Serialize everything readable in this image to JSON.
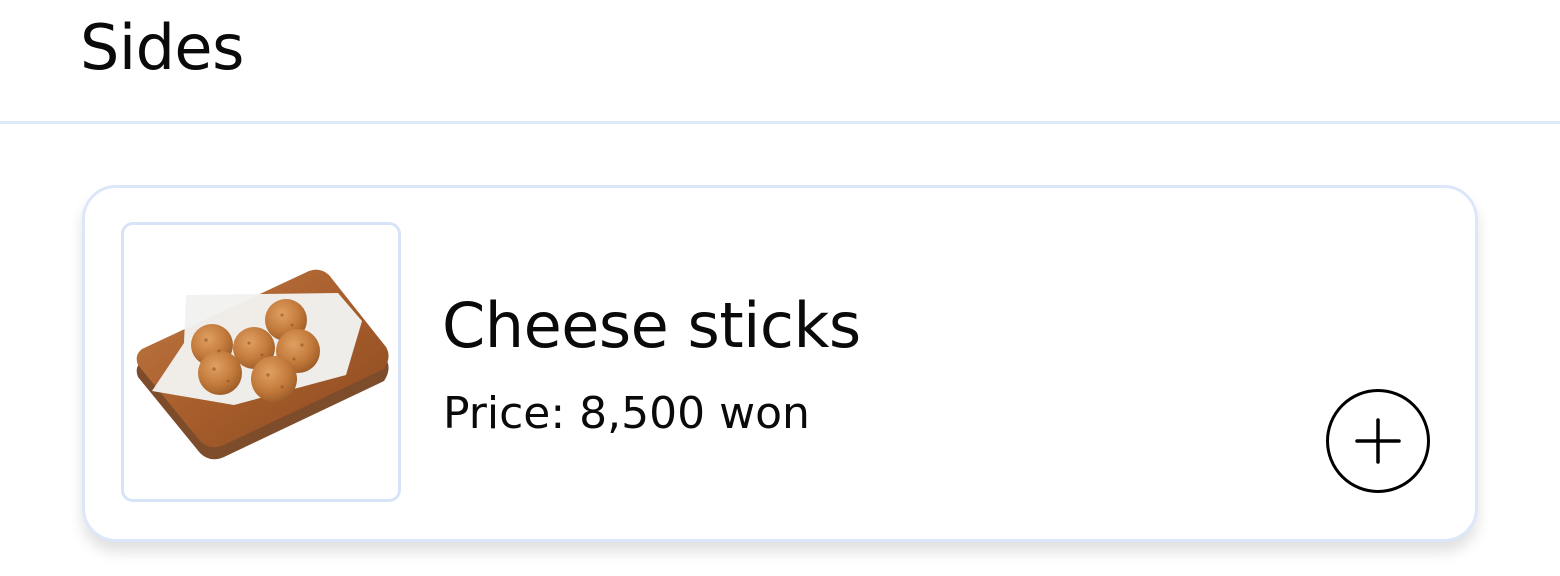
{
  "section": {
    "title": "Sides"
  },
  "menu_item": {
    "name": "Cheese sticks",
    "price": "Price: 8,500 won",
    "image_icon": "cheese-balls-on-wooden-board-photo",
    "add_icon": "plus-circle-icon"
  },
  "colors": {
    "divider": "#dde9f8",
    "card_border": "#dce8f9",
    "text": "#0a0a0a"
  }
}
